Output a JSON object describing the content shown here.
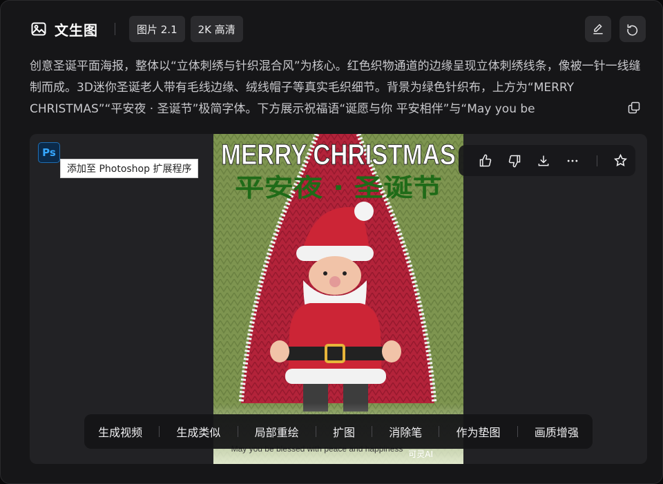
{
  "header": {
    "mode_icon": "image-icon",
    "mode_title": "文生图",
    "model_chip": "图片 2.1",
    "quality_chip": "2K 高清",
    "right_icons": [
      "edit-icon",
      "redo-icon"
    ]
  },
  "prompt": {
    "text": "创意圣诞平面海报，整体以“立体刺绣与针织混合风”为核心。红色织物通道的边缘呈现立体刺绣线条，像被一针一线缝制而成。3D迷你圣诞老人带有毛线边缘、绒线帽子等真实毛织细节。背景为绿色针织布，上方为“MERRY CHRISTMAS”“平安夜 · 圣诞节”极简字体。下方展示祝福语“诞愿与你 平安相伴”与“May you be",
    "copy_icon": "copy-icon"
  },
  "image": {
    "ps_badge": "Ps",
    "ps_tooltip": "添加至 Photoshop 扩展程序",
    "poster_title": "MERRY CHRISTMAS",
    "poster_subtitle": "平安夜 · 圣诞节",
    "poster_footer": "May you be blessed with peace and happiness",
    "watermark": "可灵AI",
    "actions": [
      "thumbs-up-icon",
      "thumbs-down-icon",
      "download-icon",
      "more-icon",
      "star-icon"
    ]
  },
  "toolbar": {
    "items": [
      "生成视频",
      "生成类似",
      "局部重绘",
      "扩图",
      "消除笔",
      "作为垫图",
      "画质增强"
    ]
  },
  "colors": {
    "panel": "#161618",
    "chip": "#2b2b2e",
    "knit_green": "#7e9550",
    "knit_red": "#b3233a",
    "subtitle_green": "#1f6b18"
  }
}
